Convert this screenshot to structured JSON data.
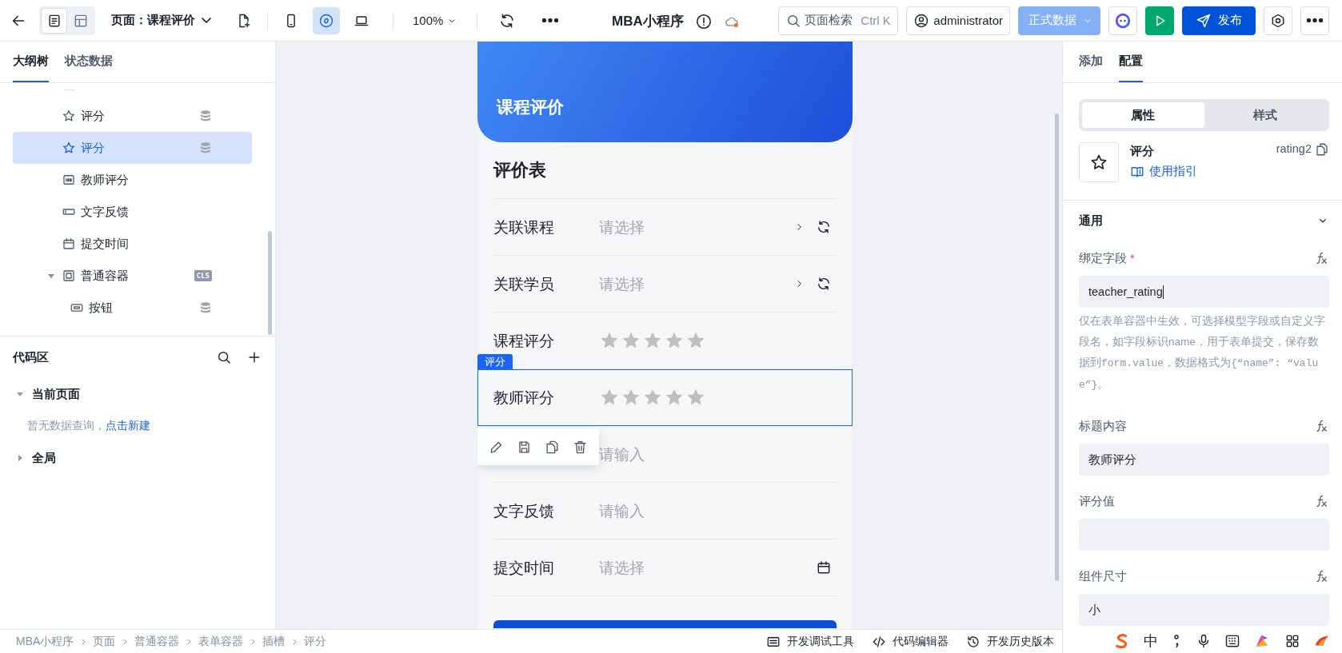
{
  "topbar": {
    "view_modes": [
      {
        "kind": "list",
        "selected": true
      },
      {
        "kind": "layout",
        "selected": false
      }
    ],
    "page_label": "页面：课程评价",
    "devices": [
      {
        "kind": "phone",
        "selected": false
      },
      {
        "kind": "link",
        "selected": true
      },
      {
        "kind": "laptop",
        "selected": false
      }
    ],
    "zoom": "100%",
    "app_title": "MBA小程序",
    "search": {
      "placeholder": "页面检索",
      "shortcut": "Ctrl K"
    },
    "user": "administrator",
    "env": "正式数据",
    "publish": "发布"
  },
  "outline": {
    "tabs": [
      {
        "label": "大纲树",
        "selected": true
      },
      {
        "label": "状态数据",
        "selected": false
      }
    ],
    "tree": [
      {
        "label": "评分",
        "kind": "star",
        "badge": {
          "kind": "database"
        },
        "selected": false
      },
      {
        "label": "评分",
        "kind": "star",
        "badge": {
          "kind": "database"
        },
        "selected": true
      },
      {
        "label": "教师评分",
        "kind": "number",
        "selected": false
      },
      {
        "label": "文字反馈",
        "kind": "input",
        "selected": false
      },
      {
        "label": "提交时间",
        "kind": "calendar",
        "selected": false
      },
      {
        "label": "普通容器",
        "kind": "container",
        "badge": {
          "kind": "text",
          "text": "CLS"
        },
        "selected": false,
        "expanded": true,
        "children": [
          {
            "label": "按钮",
            "kind": "button",
            "badge": {
              "kind": "database"
            },
            "selected": false
          }
        ]
      }
    ]
  },
  "code_area": {
    "title": "代码区",
    "groups": [
      {
        "label": "当前页面",
        "expanded": true,
        "empty_text": "暂无数据查询，",
        "link": "点击新建"
      },
      {
        "label": "全局",
        "expanded": false
      }
    ]
  },
  "phone": {
    "header_title": "课程评价",
    "form_title": "评价表",
    "selection_tag": "评分",
    "rows": [
      {
        "kind": "select",
        "label": "关联课程",
        "placeholder": "请选择",
        "selected": false
      },
      {
        "kind": "select",
        "label": "关联学员",
        "placeholder": "请选择",
        "selected": false
      },
      {
        "kind": "rating",
        "label": "课程评分",
        "stars": 0,
        "selected": false
      },
      {
        "kind": "rating",
        "label": "教师评分",
        "stars": 0,
        "selected": true
      },
      {
        "kind": "input",
        "placeholder": "请输入",
        "selected": false
      },
      {
        "kind": "input",
        "label": "文字反馈",
        "placeholder": "请输入",
        "selected": false
      },
      {
        "kind": "date",
        "label": "提交时间",
        "placeholder": "请选择",
        "selected": false
      }
    ]
  },
  "config": {
    "tabs": [
      {
        "label": "添加",
        "selected": false
      },
      {
        "label": "配置",
        "selected": true
      }
    ],
    "segments": [
      {
        "label": "属性",
        "selected": true
      },
      {
        "label": "样式",
        "selected": false
      }
    ],
    "component": {
      "name": "评分",
      "guide": "使用指引",
      "id": "rating2"
    },
    "section": {
      "title": "通用",
      "expanded": true
    },
    "fields": [
      {
        "label": "绑定字段",
        "required_mark": "*",
        "value": "teacher_rating",
        "help": [
          {
            "kind": "text",
            "text": "仅在表单容器中生效，可选择模型字段或自定义字段名，如字段标识name，用于表单提交，保存数据到"
          },
          {
            "kind": "code",
            "text": "form.value"
          },
          {
            "kind": "text",
            "text": "，数据格式为"
          },
          {
            "kind": "code",
            "text": "{“name”: “value”}"
          },
          {
            "kind": "text",
            "text": "。"
          }
        ]
      },
      {
        "label": "标题内容",
        "value": "教师评分"
      },
      {
        "label": "评分值"
      },
      {
        "label": "组件尺寸",
        "value": "小"
      }
    ]
  },
  "status_bar": {
    "breadcrumb": [
      "MBA小程序",
      "页面",
      "普通容器",
      "表单容器",
      "插槽",
      "评分"
    ],
    "tools": [
      {
        "kind": "console",
        "label": "开发调试工具"
      },
      {
        "kind": "code",
        "label": "代码编辑器"
      },
      {
        "kind": "history",
        "label": "开发历史版本"
      }
    ]
  },
  "ime": {
    "mode": "中"
  }
}
